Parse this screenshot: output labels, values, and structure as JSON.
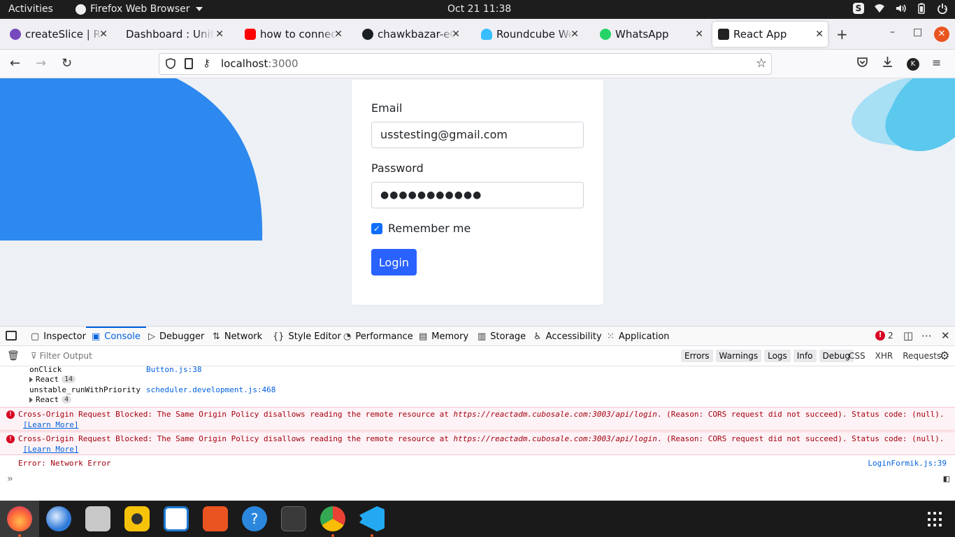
{
  "topbar": {
    "activities": "Activities",
    "app_menu": "Firefox Web Browser",
    "clock": "Oct 21  11:38"
  },
  "tabs": [
    {
      "label": "createSlice | Redux",
      "favicon_color": "#764abc"
    },
    {
      "label": "Dashboard : United X",
      "favicon_color": "#f0f0f4"
    },
    {
      "label": "how to connect cors",
      "favicon_color": "#ff0000"
    },
    {
      "label": "chawkbazar-eCom",
      "favicon_color": "#1b1f23"
    },
    {
      "label": "Roundcube Webmail",
      "favicon_color": "#37beff"
    },
    {
      "label": "WhatsApp",
      "favicon_color": "#25d366"
    },
    {
      "label": "React App",
      "favicon_color": "#222222"
    }
  ],
  "address": {
    "host": "localhost",
    "port": ":3000"
  },
  "form": {
    "email_label": "Email",
    "email_value": "usstesting@gmail.com",
    "password_label": "Password",
    "password_value": "●●●●●●●●●●●",
    "remember_label": "Remember me",
    "remember_checked": true,
    "login_label": "Login"
  },
  "devtools": {
    "tabs": [
      "Inspector",
      "Console",
      "Debugger",
      "Network",
      "Style Editor",
      "Performance",
      "Memory",
      "Storage",
      "Accessibility",
      "Application"
    ],
    "active_tab": "Console",
    "error_count": "2",
    "filter_placeholder": "Filter Output",
    "filter_buttons": [
      "Errors",
      "Warnings",
      "Logs",
      "Info",
      "Debug"
    ],
    "net_buttons": [
      "CSS",
      "XHR",
      "Requests"
    ]
  },
  "console": {
    "stack": [
      {
        "fn": "onClick",
        "src": "Button.js:38"
      },
      {
        "group": "React",
        "count": "14"
      },
      {
        "fn": "unstable_runWithPriority",
        "src": "scheduler.development.js:468"
      },
      {
        "group": "React",
        "count": "4"
      }
    ],
    "errors": [
      {
        "prefix": "Cross-Origin Request Blocked: The Same Origin Policy disallows reading the remote resource at ",
        "url": "https://reactadm.cubosale.com:3003/api/login",
        "suffix": ". (Reason: CORS request did not succeed). Status code: (null).",
        "learn": "[Learn More]"
      },
      {
        "prefix": "Cross-Origin Request Blocked: The Same Origin Policy disallows reading the remote resource at ",
        "url": "https://reactadm.cubosale.com:3003/api/login",
        "suffix": ". (Reason: CORS request did not succeed). Status code: (null).",
        "learn": "[Learn More]"
      }
    ],
    "network_error": "Error: Network Error",
    "network_error_src": "LoginFormik.js:39"
  },
  "dock": [
    {
      "name": "firefox",
      "color": "#ff7139"
    },
    {
      "name": "thunderbird",
      "color": "#2f7bd9"
    },
    {
      "name": "files",
      "color": "#c8c8c8"
    },
    {
      "name": "rhythmbox",
      "color": "#f6c30b"
    },
    {
      "name": "writer",
      "color": "#1e7bd2"
    },
    {
      "name": "software",
      "color": "#e95420"
    },
    {
      "name": "help",
      "color": "#2a87dd"
    },
    {
      "name": "terminal",
      "color": "#3a3a3a"
    },
    {
      "name": "chrome",
      "color": "#4285f4"
    },
    {
      "name": "vscode",
      "color": "#23a9f2"
    }
  ],
  "colors": {
    "accent": "#0060df",
    "login_button": "#2962ff",
    "blob_left": "#2d88ef",
    "blob_right": "#5bc8ee",
    "page_bg": "#edf1f5",
    "error": "#d70022"
  }
}
